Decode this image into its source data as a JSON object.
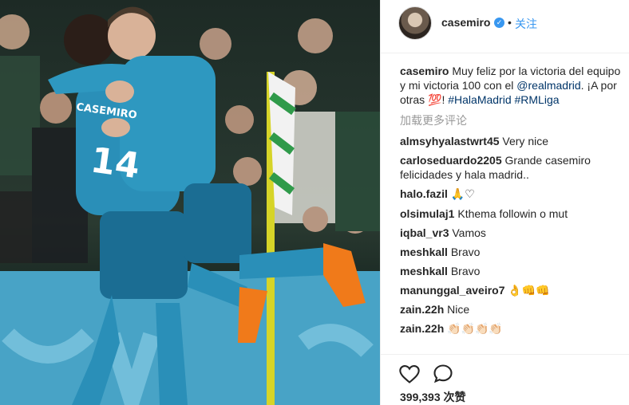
{
  "post": {
    "username": "casemiro",
    "verified_icon": "verified-badge-icon",
    "separator": "•",
    "follow_label": "关注"
  },
  "caption": {
    "username": "casemiro",
    "text_1": "Muy feliz por la victoria del equipo y mi victoria 100 con el ",
    "mention": "@realmadrid",
    "text_2": ". ¡A por otras ",
    "emoji": "💯",
    "text_3": "! ",
    "hashtag_1": "#HalaMadrid",
    "hashtag_2": "#RMLiga"
  },
  "load_more_label": "加载更多评论",
  "comments": [
    {
      "user": "almsyhyalastwrt45",
      "text": "Very nice"
    },
    {
      "user": "carloseduardo2205",
      "text": "Grande casemiro felicidades y hala madrid.."
    },
    {
      "user": "halo.fazil",
      "text": "🙏♡"
    },
    {
      "user": "olsimulaj1",
      "text": "Kthema followin o mut"
    },
    {
      "user": "iqbal_vr3",
      "text": "Vamos"
    },
    {
      "user": "meshkall",
      "text": "Bravo"
    },
    {
      "user": "meshkall",
      "text": "Bravo"
    },
    {
      "user": "manunggal_aveiro7",
      "text": "👌👊👊"
    },
    {
      "user": "zain.22h",
      "text": "Nice"
    },
    {
      "user": "zain.22h",
      "text": "👏🏻👏🏻👏🏻👏🏻"
    }
  ],
  "likes": {
    "count": "399,393",
    "label": "次赞"
  },
  "icons": {
    "like": "heart-icon",
    "comment": "speech-bubble-icon"
  },
  "colors": {
    "link": "#003569",
    "follow": "#3897f0",
    "muted": "#999999",
    "jersey": "#2a8fb8"
  }
}
